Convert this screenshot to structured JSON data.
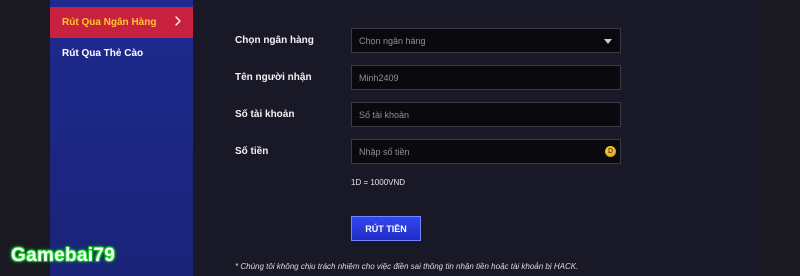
{
  "sidebar": {
    "items": [
      {
        "label": "Rút Qua Ngân Hàng",
        "active": true
      },
      {
        "label": "Rút Qua Thẻ Cào",
        "active": false
      }
    ],
    "colors": {
      "background": "#1f2a8f",
      "active_background": "#c7213f",
      "active_text": "#ffc62a"
    }
  },
  "form": {
    "bank": {
      "label": "Chọn ngân hàng",
      "selected": "Chọn ngân hàng"
    },
    "recipient": {
      "label": "Tên người nhận",
      "value": "Minh2409"
    },
    "account": {
      "label": "Số tài khoản",
      "placeholder": "Số tài khoản"
    },
    "amount": {
      "label": "Số tiền",
      "placeholder": "Nhập số tiền",
      "coin_glyph": "D"
    },
    "rate_note": "1D = 1000VND",
    "submit_label": "RÚT TIỀN",
    "disclaimer": "* Chúng tôi không chịu trách nhiệm cho việc điền sai thông tin nhận tiền hoặc tài khoản bị HACK."
  },
  "watermark": "Gamebai79",
  "icons": {
    "chevron": "chevron-right-icon",
    "caret": "caret-down-icon",
    "coin": "coin-icon"
  },
  "colors": {
    "submit_button": "#2a3ae0",
    "watermark_glow": "#2aff3a"
  }
}
